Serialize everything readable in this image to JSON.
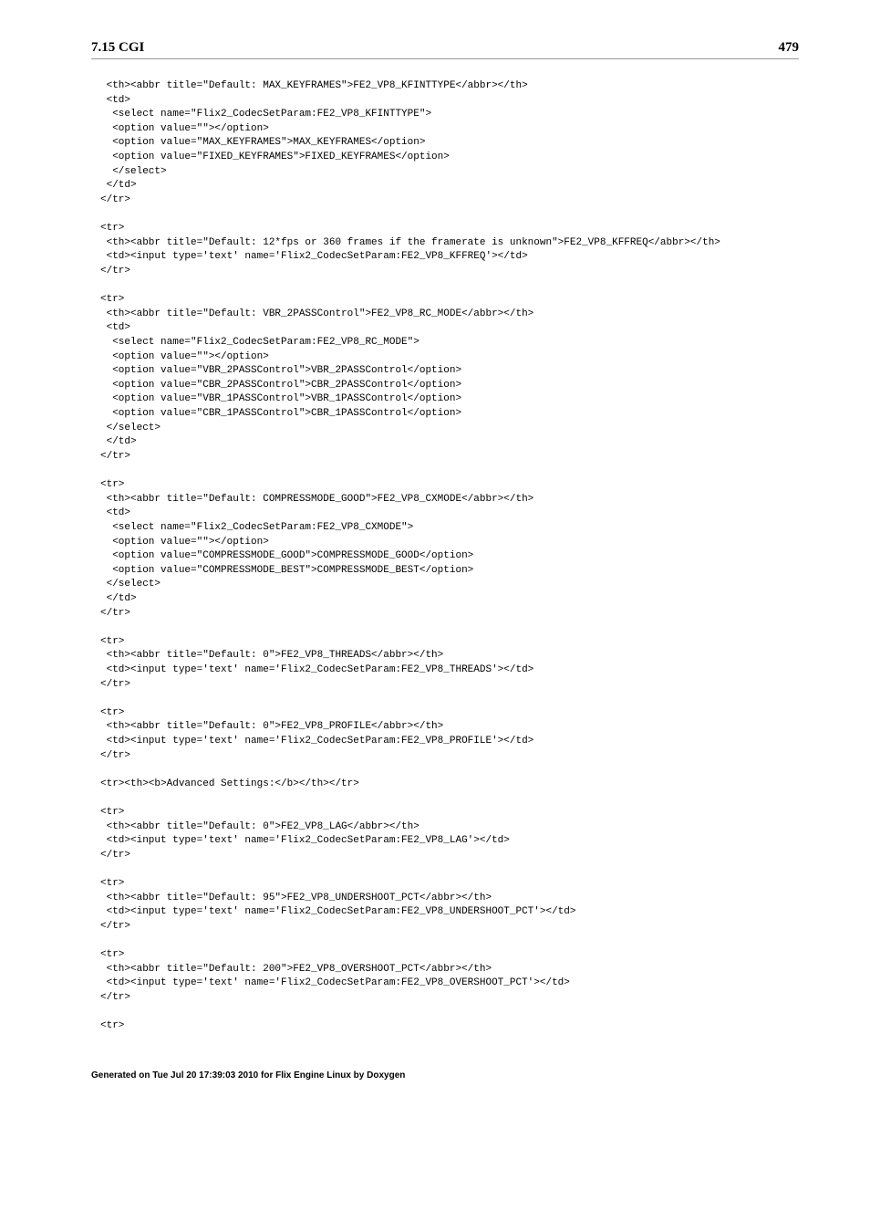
{
  "header": {
    "left": "7.15 CGI",
    "right": "479"
  },
  "code": " <th><abbr title=\"Default: MAX_KEYFRAMES\">FE2_VP8_KFINTTYPE</abbr></th>\n <td>\n  <select name=\"Flix2_CodecSetParam:FE2_VP8_KFINTTYPE\">\n  <option value=\"\"></option>\n  <option value=\"MAX_KEYFRAMES\">MAX_KEYFRAMES</option>\n  <option value=\"FIXED_KEYFRAMES\">FIXED_KEYFRAMES</option>\n  </select>\n </td>\n</tr>\n\n<tr>\n <th><abbr title=\"Default: 12*fps or 360 frames if the framerate is unknown\">FE2_VP8_KFFREQ</abbr></th>\n <td><input type='text' name='Flix2_CodecSetParam:FE2_VP8_KFFREQ'></td>\n</tr>\n\n<tr>\n <th><abbr title=\"Default: VBR_2PASSControl\">FE2_VP8_RC_MODE</abbr></th>\n <td>\n  <select name=\"Flix2_CodecSetParam:FE2_VP8_RC_MODE\">\n  <option value=\"\"></option>\n  <option value=\"VBR_2PASSControl\">VBR_2PASSControl</option>\n  <option value=\"CBR_2PASSControl\">CBR_2PASSControl</option>\n  <option value=\"VBR_1PASSControl\">VBR_1PASSControl</option>\n  <option value=\"CBR_1PASSControl\">CBR_1PASSControl</option>\n </select>\n </td>\n</tr>\n\n<tr>\n <th><abbr title=\"Default: COMPRESSMODE_GOOD\">FE2_VP8_CXMODE</abbr></th>\n <td>\n  <select name=\"Flix2_CodecSetParam:FE2_VP8_CXMODE\">\n  <option value=\"\"></option>\n  <option value=\"COMPRESSMODE_GOOD\">COMPRESSMODE_GOOD</option>\n  <option value=\"COMPRESSMODE_BEST\">COMPRESSMODE_BEST</option>\n </select>\n </td>\n</tr>\n\n<tr>\n <th><abbr title=\"Default: 0\">FE2_VP8_THREADS</abbr></th>\n <td><input type='text' name='Flix2_CodecSetParam:FE2_VP8_THREADS'></td>\n</tr>\n\n<tr>\n <th><abbr title=\"Default: 0\">FE2_VP8_PROFILE</abbr></th>\n <td><input type='text' name='Flix2_CodecSetParam:FE2_VP8_PROFILE'></td>\n</tr>\n\n<tr><th><b>Advanced Settings:</b></th></tr>\n\n<tr>\n <th><abbr title=\"Default: 0\">FE2_VP8_LAG</abbr></th>\n <td><input type='text' name='Flix2_CodecSetParam:FE2_VP8_LAG'></td>\n</tr>\n\n<tr>\n <th><abbr title=\"Default: 95\">FE2_VP8_UNDERSHOOT_PCT</abbr></th>\n <td><input type='text' name='Flix2_CodecSetParam:FE2_VP8_UNDERSHOOT_PCT'></td>\n</tr>\n\n<tr>\n <th><abbr title=\"Default: 200\">FE2_VP8_OVERSHOOT_PCT</abbr></th>\n <td><input type='text' name='Flix2_CodecSetParam:FE2_VP8_OVERSHOOT_PCT'></td>\n</tr>\n\n<tr>",
  "footer": "Generated on Tue Jul 20 17:39:03 2010 for Flix Engine Linux by Doxygen"
}
